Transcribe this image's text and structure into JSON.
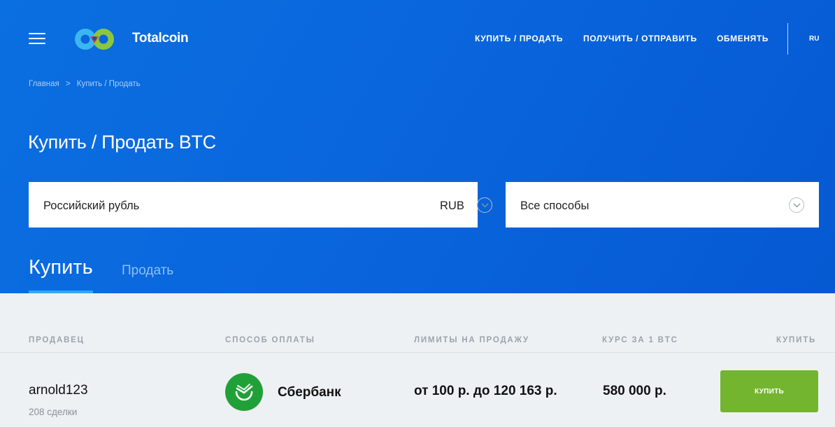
{
  "header": {
    "brand": "Totalcoin",
    "nav": [
      {
        "label": "КУПИТЬ / ПРОДАТЬ"
      },
      {
        "label": "ПОЛУЧИТЬ / ОТПРАВИТЬ"
      },
      {
        "label": "ОБМЕНЯТЬ"
      }
    ],
    "language": "RU"
  },
  "breadcrumb": {
    "home": "Главная",
    "separator": ">",
    "current": "Купить / Продать"
  },
  "page_title": "Купить / Продать BTC",
  "filters": {
    "currency": {
      "label": "Российский рубль",
      "code": "RUB"
    },
    "method": {
      "label": "Все способы"
    }
  },
  "tabs": {
    "buy": "Купить",
    "sell": "Продать",
    "active": "buy"
  },
  "table": {
    "headers": {
      "seller": "ПРОДАВЕЦ",
      "method": "СПОСОБ ОПЛАТЫ",
      "limits": "ЛИМИТЫ НА ПРОДАЖУ",
      "rate": "КУРС ЗА 1 BTC",
      "action": "КУПИТЬ"
    },
    "rows": [
      {
        "seller": "arnold123",
        "deals": "208 сделки",
        "bank": "Сбербанк",
        "limits": "от 100 р. до 120 163 р.",
        "rate": "580 000 р.",
        "button": "КУПИТЬ"
      }
    ]
  },
  "colors": {
    "hero_blue": "#0a66dd",
    "tab_underline": "#35a7ec",
    "buy_button": "#73b52f",
    "sberbank_green": "#21a038"
  }
}
